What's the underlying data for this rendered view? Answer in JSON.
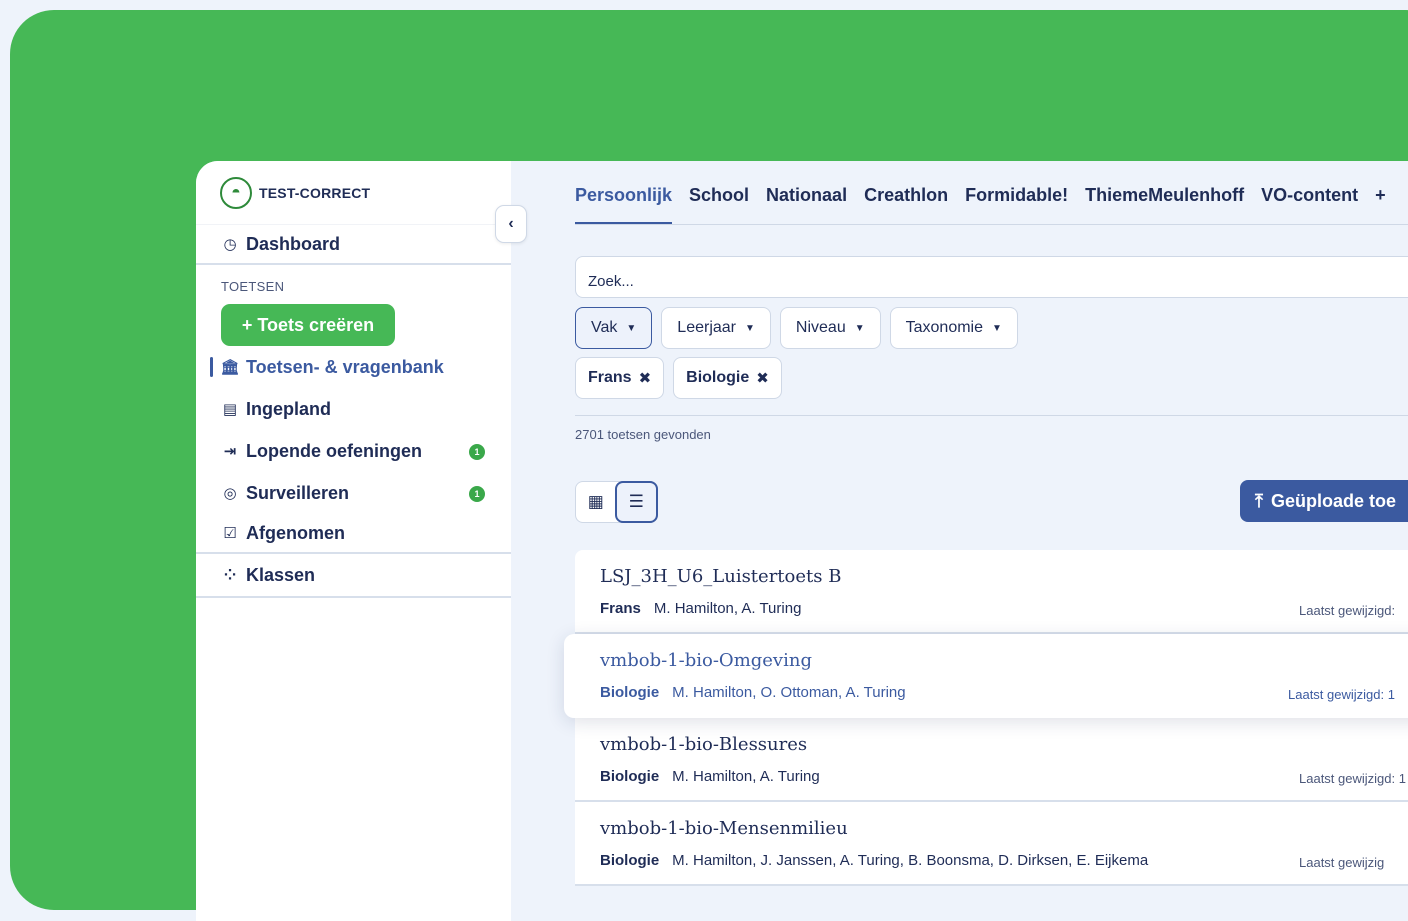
{
  "brand": {
    "name": "TEST-CORRECT"
  },
  "sidebar": {
    "dashboard": "Dashboard",
    "section_label": "TOETSEN",
    "create_button": "+ Toets creëren",
    "items": [
      {
        "label": "Toetsen- & vragenbank",
        "icon": "bank-icon",
        "active": true
      },
      {
        "label": "Ingepland",
        "icon": "calendar-icon"
      },
      {
        "label": "Lopende oefeningen",
        "icon": "running-icon",
        "badge": "1"
      },
      {
        "label": "Surveilleren",
        "icon": "radar-icon",
        "badge": "1"
      },
      {
        "label": "Afgenomen",
        "icon": "calendar-check-icon"
      }
    ],
    "classes": "Klassen"
  },
  "tabs": [
    "Persoonlijk",
    "School",
    "Nationaal",
    "Creathlon",
    "Formidable!",
    "ThiemeMeulenhoff",
    "VO-content",
    "+"
  ],
  "search": {
    "value": "Zoek..."
  },
  "filters": [
    "Vak",
    "Leerjaar",
    "Niveau",
    "Taxonomie"
  ],
  "chips": [
    "Frans",
    "Biologie"
  ],
  "results_count": "2701 toetsen gevonden",
  "upload_button": "Geüploade toe",
  "tests": [
    {
      "title": "LSJ_3H_U6_Luistertoets B",
      "subject": "Frans",
      "authors": "M. Hamilton, A. Turing",
      "modified": "Laatst gewijzigd:"
    },
    {
      "title": "vmbob-1-bio-Omgeving",
      "subject": "Biologie",
      "authors": "M. Hamilton, O. Ottoman, A. Turing",
      "modified": "Laatst gewijzigd: 1"
    },
    {
      "title": "vmbob-1-bio-Blessures",
      "subject": "Biologie",
      "authors": "M. Hamilton, A. Turing",
      "modified": "Laatst gewijzigd: 1"
    },
    {
      "title": "vmbob-1-bio-Mensenmilieu",
      "subject": "Biologie",
      "authors": "M. Hamilton, J. Janssen, A. Turing, B. Boonsma, D. Dirksen, E. Eijkema",
      "modified": "Laatst gewijzig"
    }
  ],
  "colors": {
    "brand_green": "#46b856",
    "primary_blue": "#3b5aa0",
    "text_dark": "#1f2c56"
  }
}
